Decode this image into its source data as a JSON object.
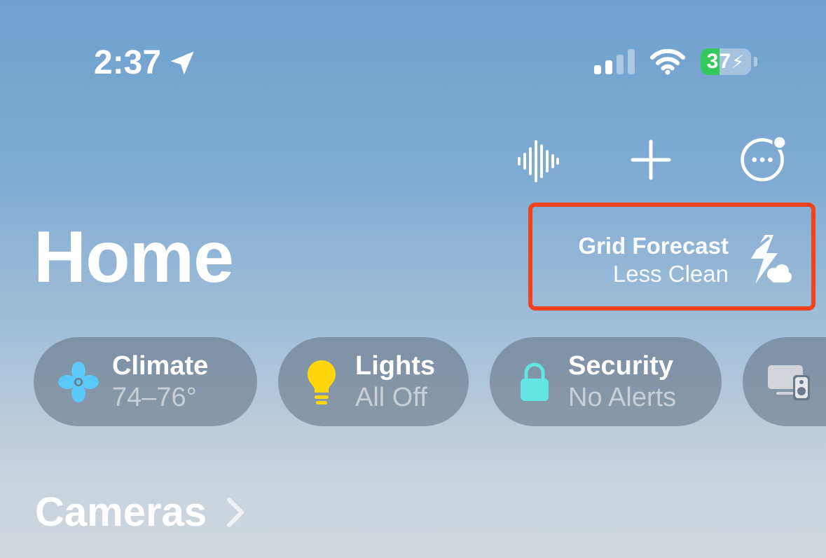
{
  "status_bar": {
    "time": "2:37",
    "battery_percent": "37",
    "battery_level": 0.37,
    "signal_bars_active": 2,
    "signal_bars_total": 4,
    "battery_color": "#34c759"
  },
  "toolbar": {
    "icons": [
      "voice-waveform-icon",
      "plus-icon",
      "more-ellipsis-icon"
    ]
  },
  "page": {
    "title": "Home"
  },
  "grid_forecast": {
    "title": "Grid Forecast",
    "status": "Less Clean",
    "highlight_color": "#f0421c"
  },
  "chips": [
    {
      "title": "Climate",
      "subtitle": "74–76°",
      "icon": "fan-icon",
      "icon_color": "#5ac8fa"
    },
    {
      "title": "Lights",
      "subtitle": "All Off",
      "icon": "lightbulb-icon",
      "icon_color": "#ffd60a"
    },
    {
      "title": "Security",
      "subtitle": "No Alerts",
      "icon": "lock-icon",
      "icon_color": "#63e6e2"
    },
    {
      "title": "",
      "subtitle": "",
      "icon": "tv-speaker-icon",
      "icon_color": "#d1d5db"
    }
  ],
  "section": {
    "title": "Cameras"
  }
}
